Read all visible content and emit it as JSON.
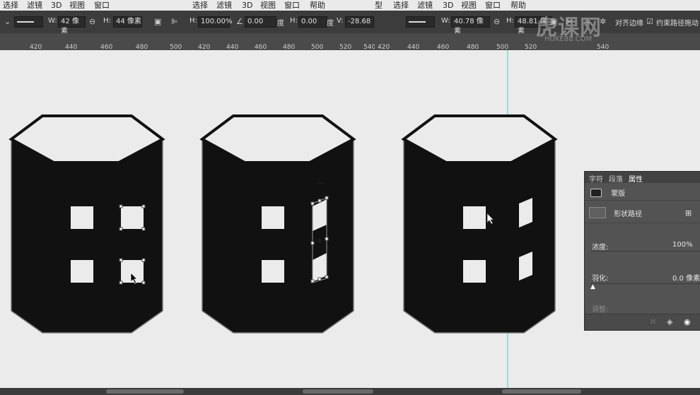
{
  "panel1": {
    "menu": [
      "选择",
      "滤镜",
      "3D",
      "视图",
      "窗口"
    ],
    "options": {
      "dropdown_left": "⌄",
      "w_label": "W:",
      "w_value": "42 像素",
      "link_icon": "link-icon",
      "h_label": "H:",
      "h_value": "44 像素"
    },
    "ruler": [
      "420",
      "440",
      "460",
      "480",
      "500"
    ]
  },
  "panel2": {
    "menu": [
      "选择",
      "滤镜",
      "3D",
      "视图",
      "窗口",
      "帮助"
    ],
    "options": {
      "h_label": "H:",
      "h_value": "100.00%",
      "angle_value": "0.00",
      "deg1": "度",
      "h2_label": "H:",
      "h2_value": "0.00",
      "deg2": "度",
      "v_label": "V:",
      "v_value": "-28.68"
    },
    "ruler": [
      "420",
      "440",
      "460",
      "480",
      "500",
      "520",
      "540"
    ]
  },
  "panel3": {
    "menu": [
      "型",
      "选择",
      "滤镜",
      "3D",
      "视图",
      "窗口",
      "帮助"
    ],
    "options": {
      "w_label": "W:",
      "w_value": "40.78 像素",
      "h_label": "H:",
      "h_value": "48.81 像素",
      "align_edges": "对齐边缘",
      "constrain_path": "约束路径拖动"
    },
    "ruler": [
      "420",
      "440",
      "460",
      "480",
      "500",
      "520",
      "540"
    ]
  },
  "properties": {
    "tabs": [
      "字符",
      "段落",
      "属性"
    ],
    "mask_label": "蒙版",
    "shape_path_label": "形状路径",
    "density_label": "浓度:",
    "density_value": "100%",
    "feather_label": "羽化:",
    "feather_value": "0.0 像素",
    "adjust_label": "调整:"
  },
  "watermark": {
    "logo": "虎课网",
    "domain": "HUKE88.COM"
  },
  "colors": {
    "toolbar": "#3c3c3c",
    "ruler": "#4a4a4a",
    "canvas": "#ebebeb",
    "shape": "#111111",
    "guide": "#3fd2c7",
    "panel": "#535353"
  }
}
